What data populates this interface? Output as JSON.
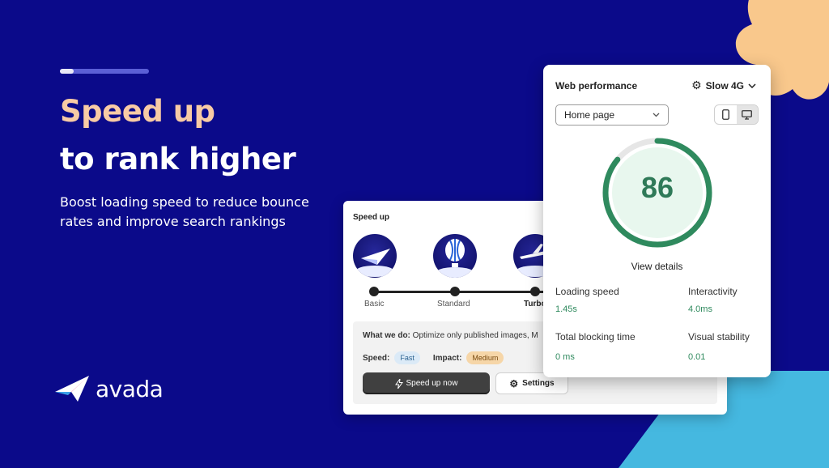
{
  "hero": {
    "progress": 0.15,
    "title_line1": "Speed up",
    "title_line2": "to rank higher",
    "subtitle": "Boost loading speed to reduce bounce rates and improve search rankings"
  },
  "brand": {
    "name": "avada",
    "logo_icon": "paper-plane-logo"
  },
  "speed_card": {
    "title": "Speed up",
    "tiers": [
      {
        "label": "Basic",
        "icon": "paper-plane-icon"
      },
      {
        "label": "Standard",
        "icon": "hot-air-balloon-icon"
      },
      {
        "label": "Turbo",
        "icon": "airplane-icon"
      }
    ],
    "what_we_do_label": "What we do:",
    "what_we_do_text": "Optimize only published images, M",
    "speed_label": "Speed:",
    "speed_value": "Fast",
    "impact_label": "Impact:",
    "impact_value": "Medium",
    "primary_button": "Speed up now",
    "secondary_button": "Settings"
  },
  "perf_card": {
    "title": "Web performance",
    "network": "Slow 4G",
    "page_select": "Home page",
    "score": "86",
    "score_fraction": 0.86,
    "view_details": "View details",
    "metrics": [
      {
        "label": "Loading speed",
        "value": "1.45s"
      },
      {
        "label": "Interactivity",
        "value": "4.0ms"
      },
      {
        "label": "Total blocking time",
        "value": "0 ms"
      },
      {
        "label": "Visual stability",
        "value": "0.01"
      }
    ]
  },
  "colors": {
    "background": "#0b0a8a",
    "accent_peach": "#f8cba5",
    "score_green": "#2f7a58",
    "accent_cyan": "#45b8e0"
  }
}
